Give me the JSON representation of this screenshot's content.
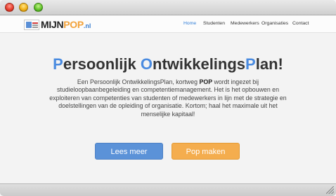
{
  "window": {
    "controls": [
      "close",
      "minimize",
      "zoom"
    ],
    "colors": {
      "close": "#e8402f",
      "minimize": "#f2b318",
      "zoom": "#62c32a"
    }
  },
  "logo": {
    "part1": "MIJN",
    "part2": "POP",
    "part3": ".nl"
  },
  "nav": {
    "items": [
      {
        "label": "Home",
        "active": true
      },
      {
        "label": "Studenten",
        "active": false
      },
      {
        "label": "Medewerkers",
        "active": false
      },
      {
        "label": "Organisaties",
        "active": false
      },
      {
        "label": "Contact",
        "active": false
      }
    ]
  },
  "hero": {
    "title_parts": [
      "P",
      "ersoonlijk ",
      "O",
      "ntwikkelings",
      "P",
      "lan!"
    ],
    "description_before": "Een Persoonlijk OntwikkelingsPlan, kortweg ",
    "description_bold": "POP",
    "description_after": " wordt ingezet bij studieloopbaanbegeleiding en competentiemanagement. Het is het opbouwen en exploiteren van competenties van studenten of medewerkers in lijn met de strategie en doelstellingen van de opleiding of organisatie. Kortom; haal het maximale uit het menselijke kapitaal!",
    "primary_button": "Lees meer",
    "secondary_button": "Pop maken"
  },
  "colors": {
    "accent_blue": "#4a8be0",
    "button_blue": "#5b92d8",
    "button_orange": "#f4ad4e",
    "nav_active": "#2d7bd6"
  }
}
